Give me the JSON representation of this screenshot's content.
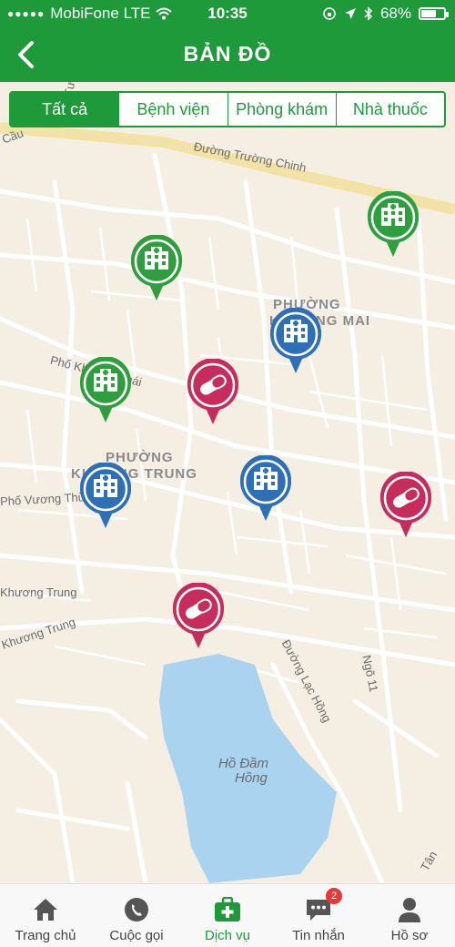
{
  "status_bar": {
    "carrier": "MobiFone LTE",
    "time": "10:35",
    "battery": "68%",
    "battery_level": 0.68
  },
  "header": {
    "title": "BẢN ĐỒ",
    "back_icon": "chevron-left-icon"
  },
  "filter": {
    "tabs": [
      "Tất cả",
      "Bệnh viện",
      "Phòng khám",
      "Nhà thuốc"
    ],
    "active": "Tất cả"
  },
  "map": {
    "labels": {
      "street_truong_chinh": "Đường Trường Chinh",
      "ward_khuong_mai_1": "PHƯỜNG",
      "ward_khuong_mai_2": "KHƯƠNG MAI",
      "ward_khuong_trung_1": "PHƯỜNG",
      "ward_khuong_trung_2": "KHƯƠNG TRUNG",
      "street_pho_khuong_thai": "Phố Khương Thái",
      "street_vuong_thua": "Phố Vương Thừa Vũ",
      "street_khuong_trung_1": "Khương Trung",
      "street_khuong_trung_2": "Khương Trung",
      "street_lac_hong": "Đường Lạc Hồng",
      "street_ngo": "Ngõ 11",
      "lake_1": "Hồ Đầm",
      "lake_2": "Hồng",
      "street_tan": "Tân",
      "street_cau": "Cầu",
      "street_tu": "Tư"
    },
    "pins": [
      {
        "kind": "hospital",
        "color": "#2e9e3e"
      },
      {
        "kind": "hospital",
        "color": "#2e9e3e"
      },
      {
        "kind": "clinic",
        "color": "#2f6fb5"
      },
      {
        "kind": "hospital",
        "color": "#2e9e3e"
      },
      {
        "kind": "pharmacy",
        "color": "#c72d5c"
      },
      {
        "kind": "clinic",
        "color": "#2f6fb5"
      },
      {
        "kind": "clinic",
        "color": "#2f6fb5"
      },
      {
        "kind": "pharmacy",
        "color": "#c72d5c"
      },
      {
        "kind": "pharmacy",
        "color": "#c72d5c"
      }
    ]
  },
  "tabbar": {
    "items": [
      {
        "label": "Trang chủ",
        "icon": "home-icon"
      },
      {
        "label": "Cuộc gọi",
        "icon": "phone-icon"
      },
      {
        "label": "Dịch vụ",
        "icon": "medical-kit-icon"
      },
      {
        "label": "Tin nhắn",
        "icon": "chat-icon"
      },
      {
        "label": "Hồ sơ",
        "icon": "profile-icon"
      }
    ],
    "active": "Dịch vụ",
    "messages_badge": "2"
  },
  "colors": {
    "brand": "#1f9a3b",
    "hospital": "#2e9e3e",
    "clinic": "#2f6fb5",
    "pharmacy": "#c72d5c",
    "lake": "#a9d3ee"
  }
}
